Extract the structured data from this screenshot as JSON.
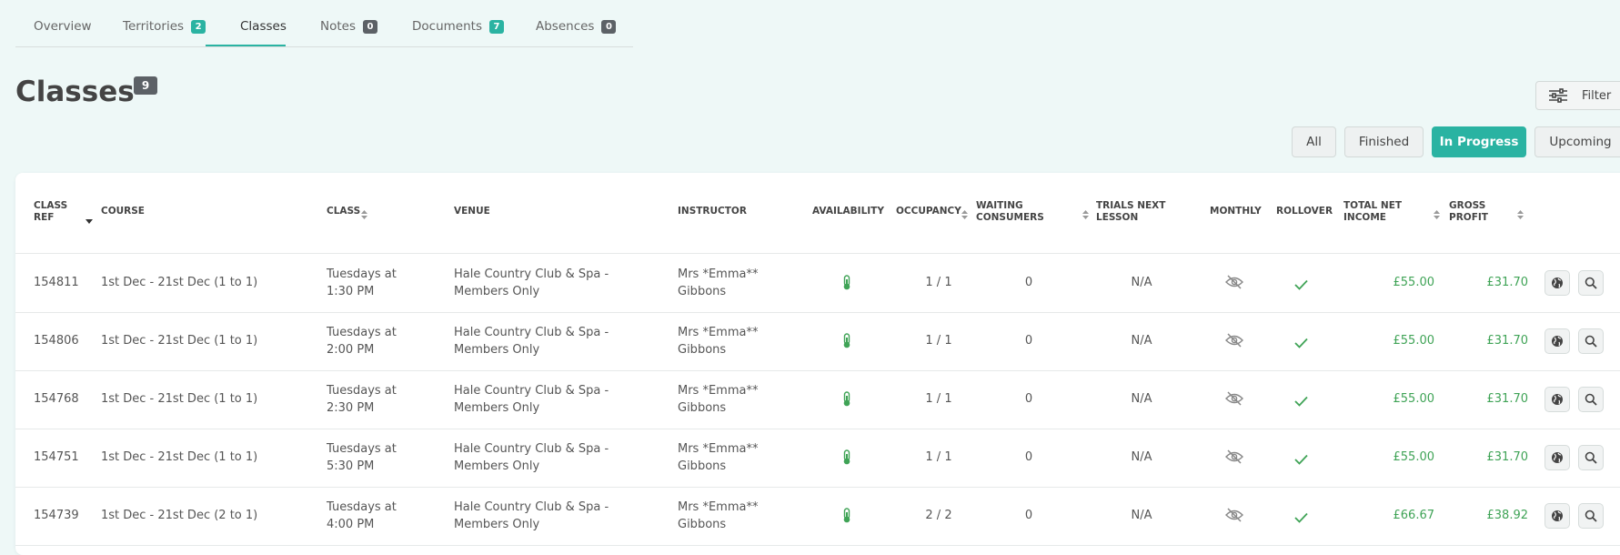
{
  "tabs": [
    {
      "label": "Overview",
      "badge": null
    },
    {
      "label": "Territories",
      "badge": "2"
    },
    {
      "label": "Classes",
      "badge": null
    },
    {
      "label": "Notes",
      "badge": "0"
    },
    {
      "label": "Documents",
      "badge": "7"
    },
    {
      "label": "Absences",
      "badge": "0"
    }
  ],
  "page": {
    "title": "Classes",
    "count": "9",
    "filter_label": "Filter"
  },
  "segments": [
    "All",
    "Finished",
    "In Progress",
    "Upcoming"
  ],
  "active_segment": "In Progress",
  "table": {
    "headers": {
      "class_ref": "CLASS REF",
      "course": "COURSE",
      "class": "CLASS",
      "venue": "VENUE",
      "instructor": "INSTRUCTOR",
      "availability": "AVAILABILITY",
      "occupancy": "OCCUPANCY",
      "waiting": "WAITING CONSUMERS",
      "trials": "TRIALS NEXT LESSON",
      "monthly": "MONTHLY",
      "rollover": "ROLLOVER",
      "total_net_income": "TOTAL NET INCOME",
      "gross_profit": "GROSS PROFIT"
    },
    "rows": [
      {
        "ref": "154811",
        "course": "1st Dec - 21st Dec (1 to 1)",
        "class": "Tuesdays at 1:30 PM",
        "venue": "Hale Country Club & Spa - Members Only",
        "instructor": "Mrs *Emma** Gibbons",
        "occupancy": "1 / 1",
        "waiting": "0",
        "trials": "N/A",
        "net_income": "£55.00",
        "gross_profit": "£31.70"
      },
      {
        "ref": "154806",
        "course": "1st Dec - 21st Dec (1 to 1)",
        "class": "Tuesdays at 2:00 PM",
        "venue": "Hale Country Club & Spa - Members Only",
        "instructor": "Mrs *Emma** Gibbons",
        "occupancy": "1 / 1",
        "waiting": "0",
        "trials": "N/A",
        "net_income": "£55.00",
        "gross_profit": "£31.70"
      },
      {
        "ref": "154768",
        "course": "1st Dec - 21st Dec (1 to 1)",
        "class": "Tuesdays at 2:30 PM",
        "venue": "Hale Country Club & Spa - Members Only",
        "instructor": "Mrs *Emma** Gibbons",
        "occupancy": "1 / 1",
        "waiting": "0",
        "trials": "N/A",
        "net_income": "£55.00",
        "gross_profit": "£31.70"
      },
      {
        "ref": "154751",
        "course": "1st Dec - 21st Dec (1 to 1)",
        "class": "Tuesdays at 5:30 PM",
        "venue": "Hale Country Club & Spa - Members Only",
        "instructor": "Mrs *Emma** Gibbons",
        "occupancy": "1 / 1",
        "waiting": "0",
        "trials": "N/A",
        "net_income": "£55.00",
        "gross_profit": "£31.70"
      },
      {
        "ref": "154739",
        "course": "1st Dec - 21st Dec (2 to 1)",
        "class": "Tuesdays at 4:00 PM",
        "venue": "Hale Country Club & Spa - Members Only",
        "instructor": "Mrs *Emma** Gibbons",
        "occupancy": "2 / 2",
        "waiting": "0",
        "trials": "N/A",
        "net_income": "£66.67",
        "gross_profit": "£38.92"
      }
    ]
  },
  "icons": {
    "availability": "thermometer-icon",
    "monthly": "eye-slash-icon",
    "rollover": "check-icon",
    "action_1": "globe-icon",
    "action_2": "search-icon",
    "filter": "sliders-icon"
  },
  "colors": {
    "accent": "#2ab3a2",
    "money": "#3fa356",
    "badge_gray": "#5c6166"
  }
}
